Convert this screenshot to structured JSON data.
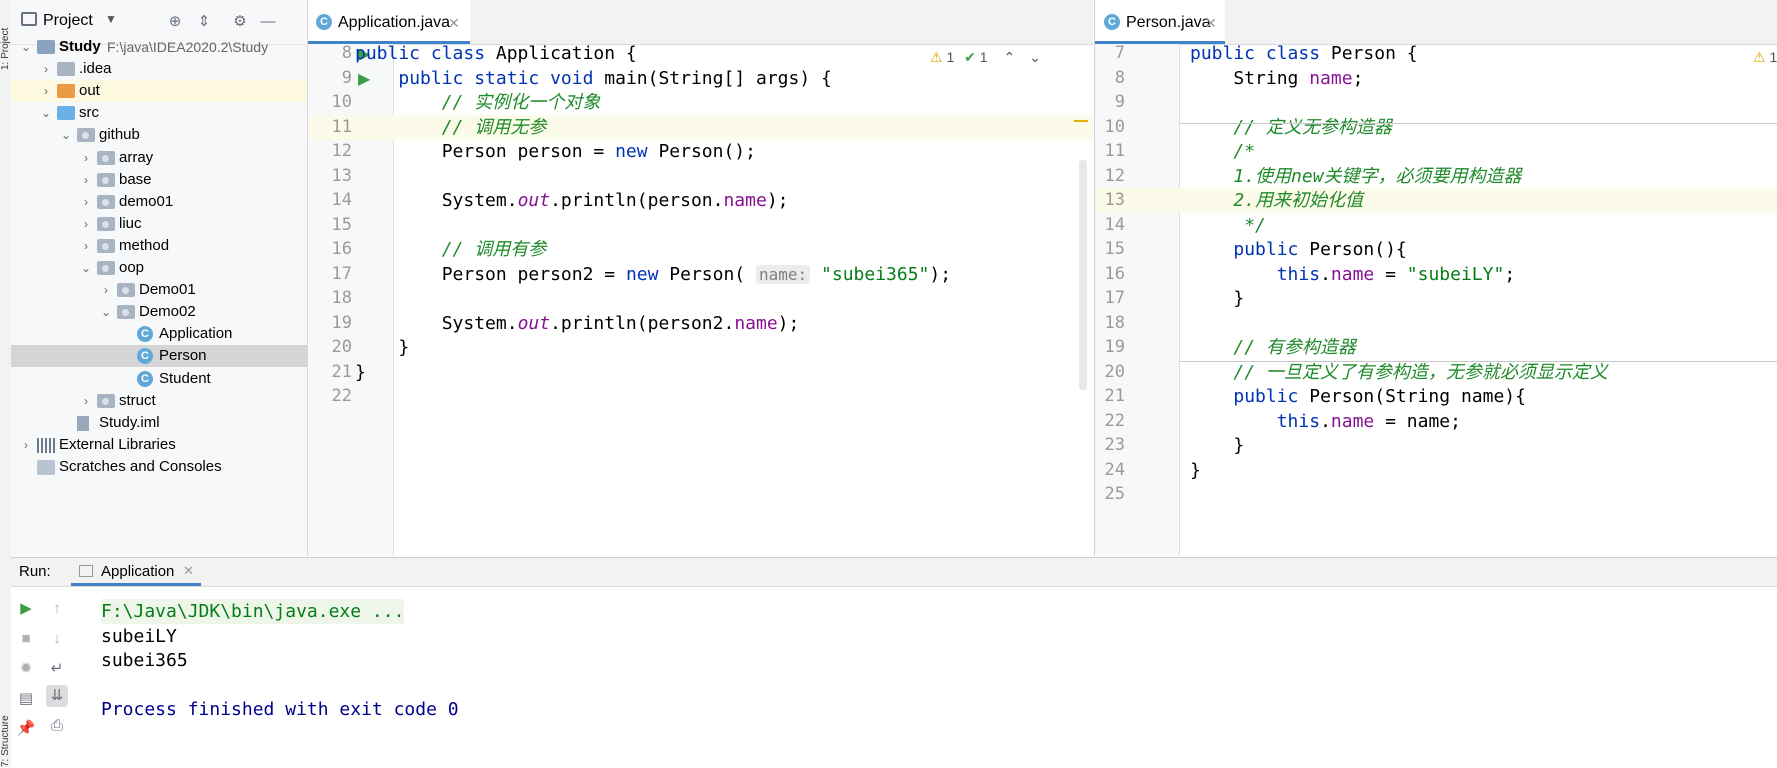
{
  "side_tabs": {
    "project": "1: Project",
    "structure": "7: Structure"
  },
  "project_panel": {
    "title": "Project",
    "tree": [
      {
        "label": "Study",
        "detail": "F:\\java\\IDEA2020.2\\Study",
        "depth": 0,
        "arrow": "expanded",
        "icon": "module-folder",
        "bold": true
      },
      {
        "label": ".idea",
        "depth": 1,
        "arrow": "collapsed",
        "icon": "folder"
      },
      {
        "label": "out",
        "depth": 1,
        "arrow": "collapsed",
        "icon": "folder-orange",
        "highlight": "yellow"
      },
      {
        "label": "src",
        "depth": 1,
        "arrow": "expanded",
        "icon": "folder-blue"
      },
      {
        "label": "github",
        "depth": 2,
        "arrow": "expanded",
        "icon": "package"
      },
      {
        "label": "array",
        "depth": 3,
        "arrow": "collapsed",
        "icon": "package"
      },
      {
        "label": "base",
        "depth": 3,
        "arrow": "collapsed",
        "icon": "package"
      },
      {
        "label": "demo01",
        "depth": 3,
        "arrow": "collapsed",
        "icon": "package"
      },
      {
        "label": "liuc",
        "depth": 3,
        "arrow": "collapsed",
        "icon": "package"
      },
      {
        "label": "method",
        "depth": 3,
        "arrow": "collapsed",
        "icon": "package"
      },
      {
        "label": "oop",
        "depth": 3,
        "arrow": "expanded",
        "icon": "package"
      },
      {
        "label": "Demo01",
        "depth": 4,
        "arrow": "collapsed",
        "icon": "package"
      },
      {
        "label": "Demo02",
        "depth": 4,
        "arrow": "expanded",
        "icon": "package"
      },
      {
        "label": "Application",
        "depth": 5,
        "arrow": "none",
        "icon": "class-run"
      },
      {
        "label": "Person",
        "depth": 5,
        "arrow": "none",
        "icon": "class",
        "selected": true
      },
      {
        "label": "Student",
        "depth": 5,
        "arrow": "none",
        "icon": "class"
      },
      {
        "label": "struct",
        "depth": 3,
        "arrow": "collapsed",
        "icon": "package"
      },
      {
        "label": "Study.iml",
        "depth": 2,
        "arrow": "none",
        "icon": "iml-file"
      },
      {
        "label": "External Libraries",
        "depth": 0,
        "arrow": "collapsed",
        "icon": "libraries"
      },
      {
        "label": "Scratches and Consoles",
        "depth": 0,
        "arrow": "none",
        "icon": "scratches"
      }
    ]
  },
  "editor_left": {
    "tab_label": "Application.java",
    "warnings": "1",
    "checks": "1",
    "lines": [
      {
        "num": "8",
        "run": true,
        "html": "<span class='kw'>public class</span> Application {"
      },
      {
        "num": "9",
        "run": true,
        "html": "    <span class='kw'>public static void</span> main(String[] args) {"
      },
      {
        "num": "10",
        "html": "        <span class='cmt'>// 实例化一个对象</span>"
      },
      {
        "num": "11",
        "html": "        <span class='cmt'>// 调用无参</span>",
        "current": true
      },
      {
        "num": "12",
        "html": "        Person person = <span class='kw'>new</span> Person();"
      },
      {
        "num": "13",
        "html": ""
      },
      {
        "num": "14",
        "html": "        System.<span class='ital'>out</span>.println(person.<span class='fld'>name</span>);"
      },
      {
        "num": "15",
        "html": ""
      },
      {
        "num": "16",
        "html": "        <span class='cmt'>// 调用有参</span>"
      },
      {
        "num": "17",
        "html": "        Person person2 = <span class='kw'>new</span> Person( <span class='hint'>name:</span> <span class='str'>\"subei365\"</span>);"
      },
      {
        "num": "18",
        "html": ""
      },
      {
        "num": "19",
        "html": "        System.<span class='ital'>out</span>.println(person2.<span class='fld'>name</span>);"
      },
      {
        "num": "20",
        "html": "    }"
      },
      {
        "num": "21",
        "html": "}"
      },
      {
        "num": "22",
        "html": ""
      }
    ]
  },
  "editor_right": {
    "tab_label": "Person.java",
    "warnings": "1",
    "lines": [
      {
        "num": "7",
        "html": "<span class='kw'>public class</span> Person {"
      },
      {
        "num": "8",
        "html": "    String <span class='fld'>name</span>;"
      },
      {
        "num": "9",
        "html": ""
      },
      {
        "num": "10",
        "html": "    <span class='cmt'>// 定义无参构造器</span>"
      },
      {
        "num": "11",
        "html": "    <span class='cmt'>/*</span>"
      },
      {
        "num": "12",
        "html": "    <span class='cmt'>1.使用new关键字，必须要用构造器</span>"
      },
      {
        "num": "13",
        "html": "    <span class='cmt'>2.用来初始化值</span>",
        "current": true
      },
      {
        "num": "14",
        "html": "     <span class='cmt'>*/</span>"
      },
      {
        "num": "15",
        "html": "    <span class='kw'>public</span> Person(){"
      },
      {
        "num": "16",
        "html": "        <span class='kw'>this</span>.<span class='fld'>name</span> = <span class='str'>\"subeiLY\"</span>;"
      },
      {
        "num": "17",
        "html": "    }"
      },
      {
        "num": "18",
        "html": ""
      },
      {
        "num": "19",
        "html": "    <span class='cmt'>// 有参构造器</span>"
      },
      {
        "num": "20",
        "html": "    <span class='cmt'>// 一旦定义了有参构造，无参就必须显示定义</span>"
      },
      {
        "num": "21",
        "html": "    <span class='kw'>public</span> Person(String name){"
      },
      {
        "num": "22",
        "html": "        <span class='kw'>this</span>.<span class='fld'>name</span> = name;"
      },
      {
        "num": "23",
        "html": "    }"
      },
      {
        "num": "24",
        "html": "}"
      },
      {
        "num": "25",
        "html": ""
      }
    ]
  },
  "run_panel": {
    "label": "Run:",
    "tab_label": "Application",
    "output": [
      {
        "text": "F:\\Java\\JDK\\bin\\java.exe ...",
        "style": "cmd"
      },
      {
        "text": "subeiLY",
        "style": "normal"
      },
      {
        "text": "subei365",
        "style": "normal"
      },
      {
        "text": "",
        "style": "normal"
      },
      {
        "text": "Process finished with exit code 0",
        "style": "exit"
      }
    ]
  },
  "colors": {
    "keyword": "#0033b3",
    "field": "#871094",
    "comment": "#1f8a2a",
    "string": "#067d17",
    "exit_text": "#00008b",
    "tab_underline": "#4083c9"
  }
}
